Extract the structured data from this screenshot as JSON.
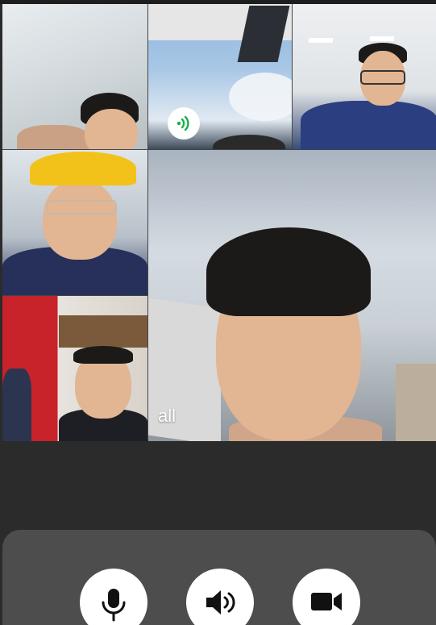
{
  "call": {
    "main_label": "all",
    "participant_count": 6
  },
  "controls": {
    "mic_icon": "microphone-icon",
    "speaker_icon": "speaker-icon",
    "camera_icon": "video-camera-icon"
  },
  "colors": {
    "background": "#2b2b2b",
    "control_panel": "#4d4d4d",
    "button": "#ffffff",
    "icon": "#111111",
    "signal": "#18b04a"
  }
}
